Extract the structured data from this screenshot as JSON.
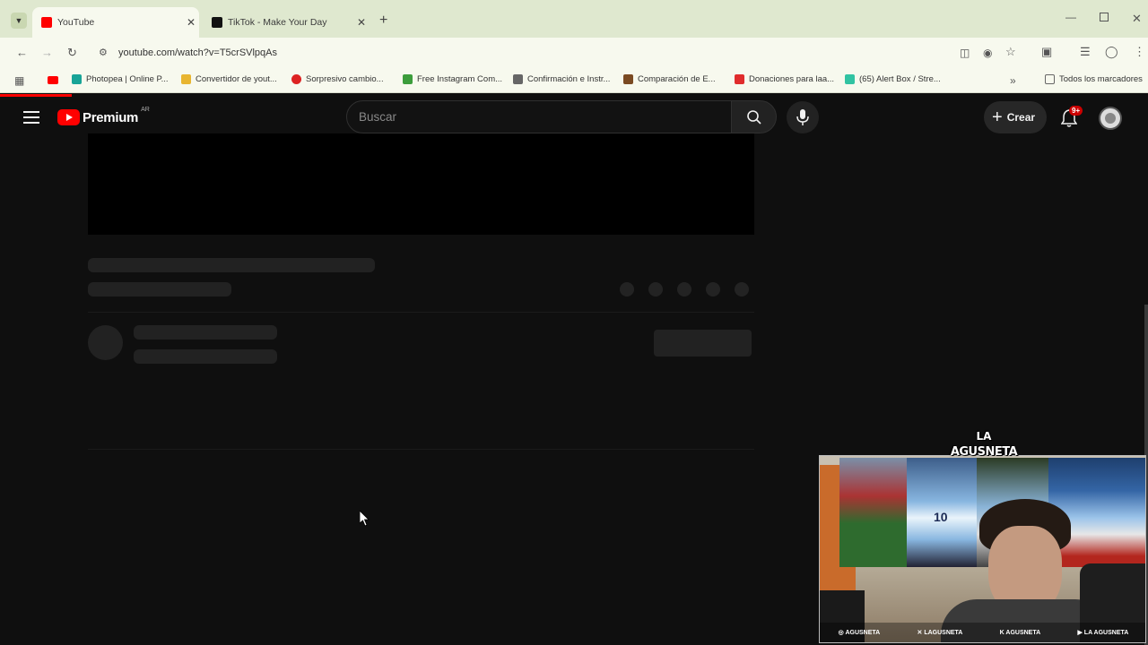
{
  "browser": {
    "tabs": [
      {
        "title": "YouTube",
        "active": true
      },
      {
        "title": "TikTok - Make Your Day",
        "active": false
      }
    ],
    "url": "youtube.com/watch?v=T5crSVlpqAs",
    "bookmarks": [
      "Photopea | Online P...",
      "Convertidor de yout...",
      "Sorpresivo cambio...",
      "Free Instagram Com...",
      "Confirmación e Instr...",
      "Comparación de E...",
      "Donaciones para laa...",
      "(65) Alert Box / Stre..."
    ],
    "all_bookmarks": "Todos los marcadores"
  },
  "youtube": {
    "logo_text": "Premium",
    "region": "AR",
    "search_placeholder": "Buscar",
    "create_label": "Crear",
    "notif_badge": "9+"
  },
  "overlay": {
    "logo_line1": "LA",
    "logo_line2": "AGUSNETA",
    "jersey_number": "10",
    "socials": [
      "AGUSNETA",
      "LAGUSNETA",
      "AGUSNETA",
      "LA AGUSNETA"
    ]
  },
  "colors": {
    "accent": "#ff0000",
    "chrome": "#dfe8cf",
    "toolbar": "#f7f9ee",
    "page_bg": "#0f0f0f"
  }
}
